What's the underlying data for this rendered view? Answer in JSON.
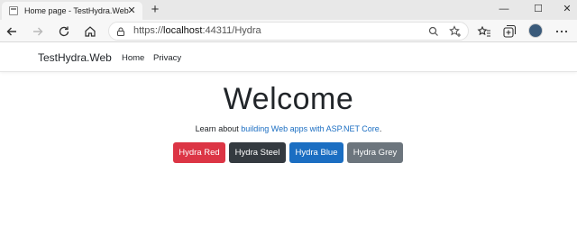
{
  "browser": {
    "tab": {
      "title": "Home page - TestHydra.Web",
      "close_glyph": "✕"
    },
    "new_tab_glyph": "+",
    "window_controls": {
      "minimize": "—",
      "maximize": "☐",
      "close": "✕"
    },
    "url": {
      "scheme": "https://",
      "host": "localhost",
      "rest": ":44311/Hydra"
    },
    "icons": [
      "back-icon",
      "forward-icon",
      "refresh-icon",
      "home-icon",
      "lock-icon",
      "zoom-icon",
      "add-favorite-icon",
      "favorites-icon",
      "collections-icon",
      "profile-avatar",
      "more-icon"
    ]
  },
  "site": {
    "brand": "TestHydra.Web",
    "nav": [
      "Home",
      "Privacy"
    ]
  },
  "main": {
    "heading": "Welcome",
    "lead_prefix": "Learn about ",
    "lead_link": "building Web apps with ASP.NET Core",
    "lead_suffix": ".",
    "buttons": [
      {
        "label": "Hydra Red",
        "color": "#dc3545"
      },
      {
        "label": "Hydra Steel",
        "color": "#343a40"
      },
      {
        "label": "Hydra Blue",
        "color": "#1b6ec2"
      },
      {
        "label": "Hydra Grey",
        "color": "#6c757d"
      }
    ]
  }
}
